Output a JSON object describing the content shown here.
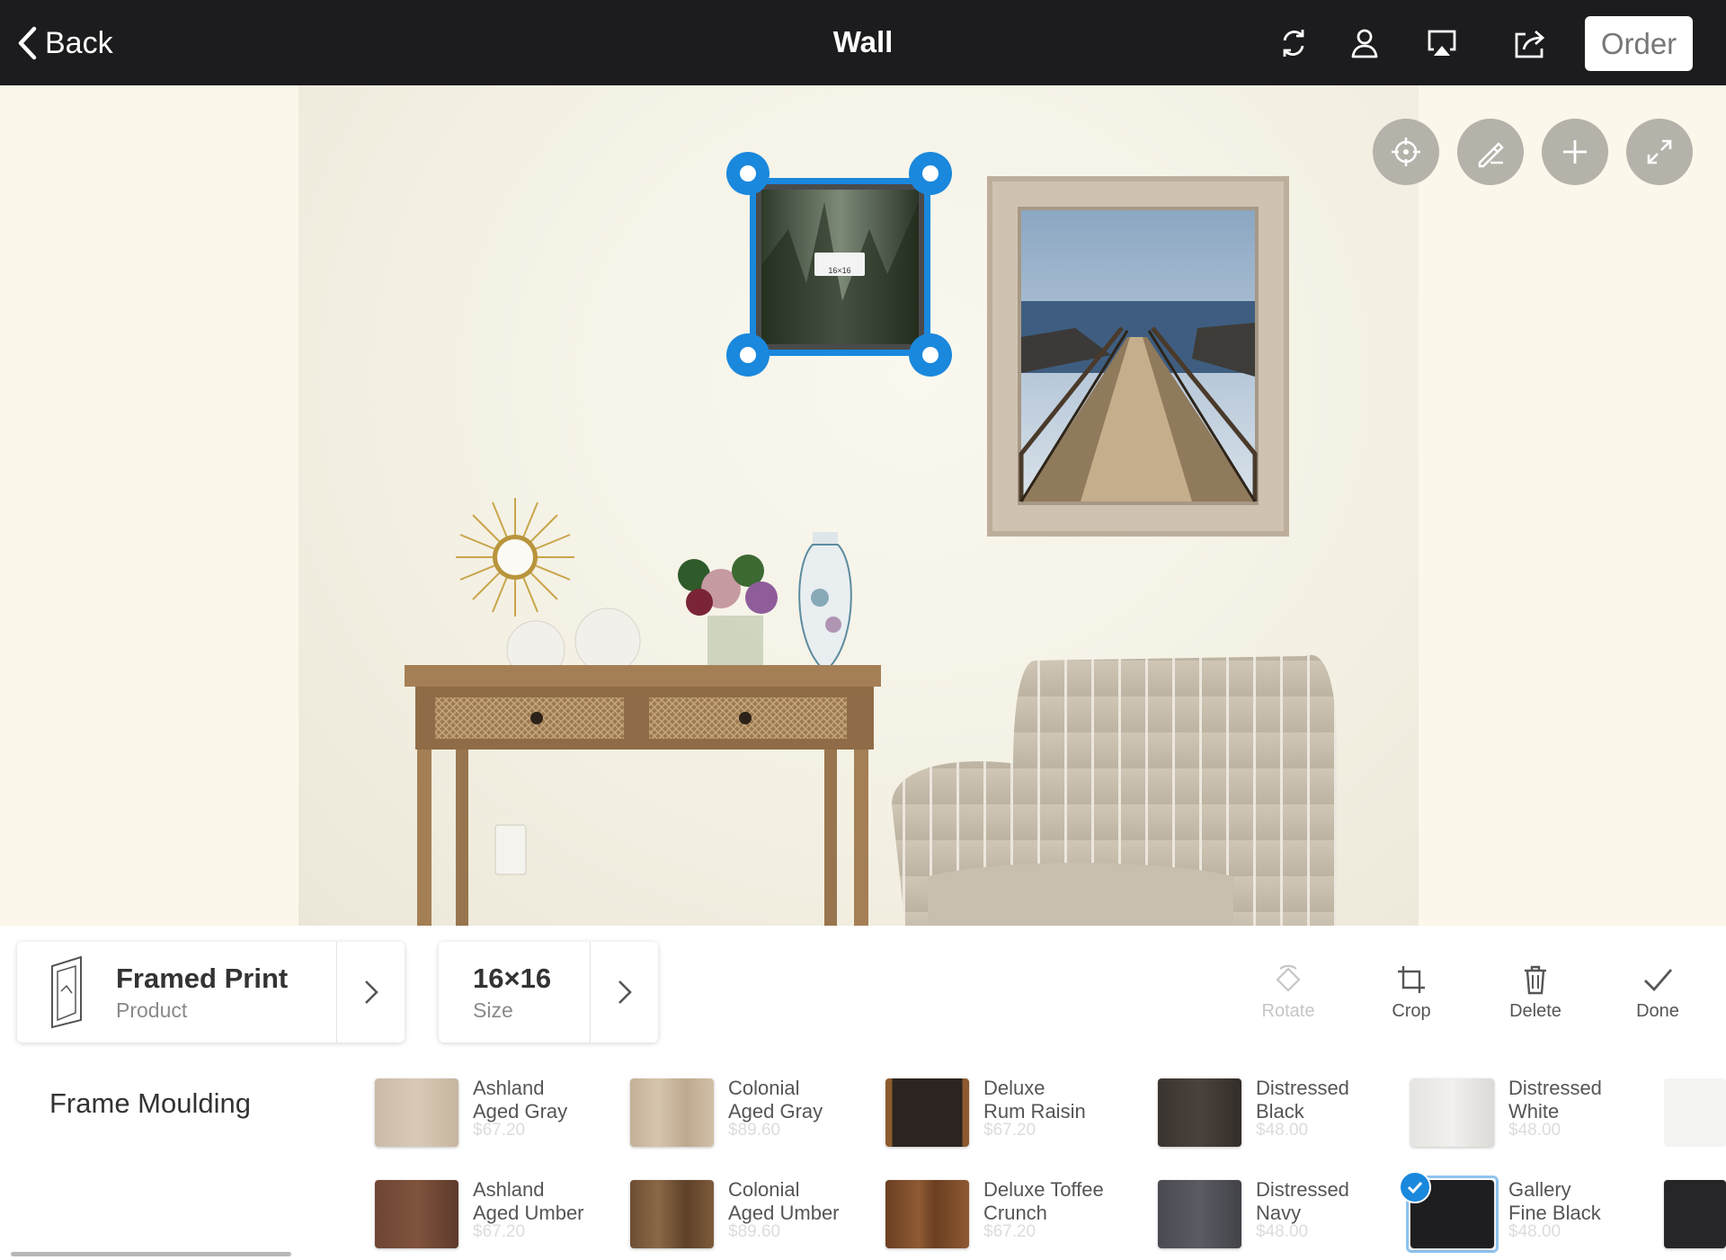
{
  "nav": {
    "back_label": "Back",
    "title": "Wall",
    "order_label": "Order",
    "icons": [
      "refresh-icon",
      "user-icon",
      "airplay-icon",
      "share-icon"
    ]
  },
  "canvas": {
    "floating_buttons": [
      "target-icon",
      "ruler-pencil-icon",
      "plus-icon",
      "expand-icon"
    ],
    "selected_frame": {
      "size_label": "16×16"
    },
    "colors": {
      "handle": "#1a88dd",
      "wall": "#f4f1e4"
    }
  },
  "panel": {
    "product": {
      "title": "Framed Print",
      "subtitle": "Product"
    },
    "size": {
      "title": "16×16",
      "subtitle": "Size"
    },
    "tools": [
      {
        "label": "Rotate",
        "icon": "rotate-icon",
        "enabled": false
      },
      {
        "label": "Crop",
        "icon": "crop-icon",
        "enabled": true
      },
      {
        "label": "Delete",
        "icon": "trash-icon",
        "enabled": true
      },
      {
        "label": "Done",
        "icon": "check-icon",
        "enabled": true
      }
    ],
    "section_label": "Frame Moulding",
    "mouldings": [
      {
        "name": "Ashland\nAged Gray",
        "price": "$67.20",
        "color": "#cbbba6"
      },
      {
        "name": "Colonial\nAged Gray",
        "price": "$89.60",
        "color": "#c9b69e"
      },
      {
        "name": "Deluxe\nRum Raisin",
        "price": "$67.20",
        "color": "#2b2420"
      },
      {
        "name": "Distressed\nBlack",
        "price": "$48.00",
        "color": "#3a3430"
      },
      {
        "name": "Distressed\nWhite",
        "price": "$48.00",
        "color": "#e6e4e0"
      },
      {
        "name": "Ashland\nAged Umber",
        "price": "$67.20",
        "color": "#6e4533"
      },
      {
        "name": "Colonial\nAged Umber",
        "price": "$89.60",
        "color": "#6e4e33"
      },
      {
        "name": "Deluxe Toffee\nCrunch",
        "price": "$67.20",
        "color": "#7a4b2b"
      },
      {
        "name": "Distressed\nNavy",
        "price": "$48.00",
        "color": "#4a4a52"
      },
      {
        "name": "Gallery\nFine Black",
        "price": "$48.00",
        "color": "#1e1e20",
        "selected": true
      }
    ]
  }
}
